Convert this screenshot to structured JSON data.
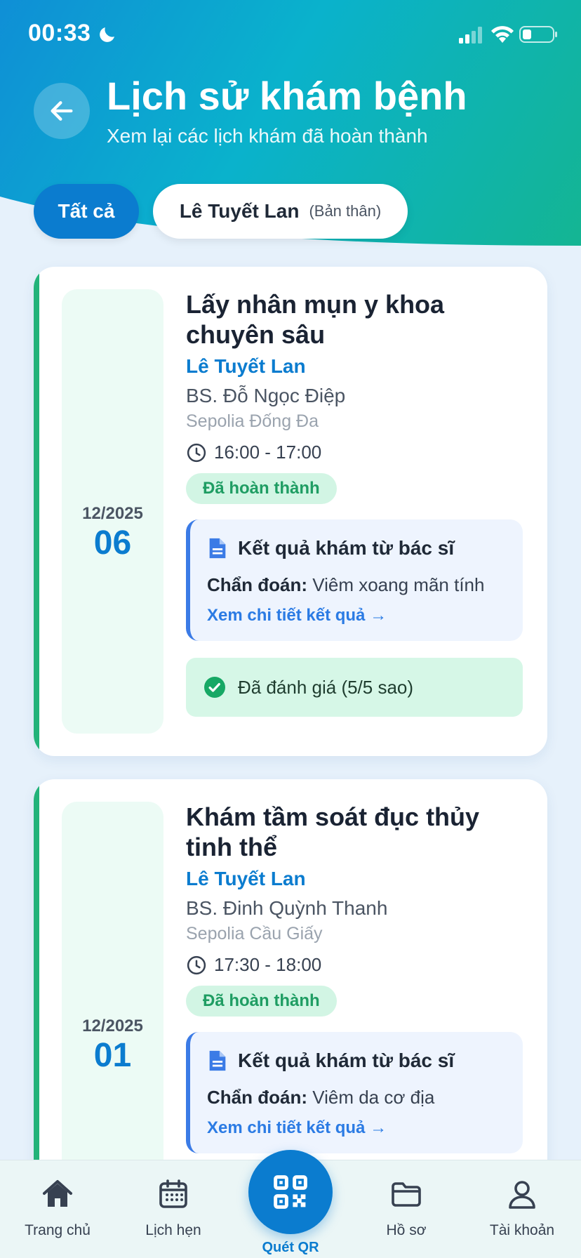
{
  "status_bar": {
    "time": "00:33"
  },
  "header": {
    "title": "Lịch sử khám bệnh",
    "subtitle": "Xem lại các lịch khám đã hoàn thành"
  },
  "filters": {
    "all_label": "Tất cả",
    "person_name": "Lê Tuyết Lan",
    "person_relation": "(Bản thân)"
  },
  "appointments": [
    {
      "month_year": "12/2025",
      "day": "06",
      "service": "Lấy nhân mụn y khoa chuyên sâu",
      "patient": "Lê Tuyết Lan",
      "doctor": "BS. Đỗ Ngọc Điệp",
      "clinic": "Sepolia Đống Đa",
      "time": "16:00 - 17:00",
      "status": "Đã hoàn thành",
      "result_title": "Kết quả khám từ bác sĩ",
      "diagnosis_label": "Chẩn đoán:",
      "diagnosis": "Viêm xoang mãn tính",
      "result_link": "Xem chi tiết kết quả →",
      "review": "Đã đánh giá (5/5 sao)"
    },
    {
      "month_year": "12/2025",
      "day": "01",
      "service": "Khám tầm soát đục thủy tinh thể",
      "patient": "Lê Tuyết Lan",
      "doctor": "BS. Đinh Quỳnh Thanh",
      "clinic": "Sepolia Cầu Giấy",
      "time": "17:30 - 18:00",
      "status": "Đã hoàn thành",
      "result_title": "Kết quả khám từ bác sĩ",
      "diagnosis_label": "Chẩn đoán:",
      "diagnosis": "Viêm da cơ địa",
      "result_link": "Xem chi tiết kết quả →"
    }
  ],
  "bottom_nav": {
    "home": "Trang chủ",
    "appointments": "Lịch hẹn",
    "qr": "Quét QR",
    "records": "Hồ sơ",
    "account": "Tài khoản"
  },
  "colors": {
    "primary": "#0b7ccf",
    "success": "#22b37a",
    "header_start": "#0f8fd6",
    "header_end": "#14b592"
  }
}
